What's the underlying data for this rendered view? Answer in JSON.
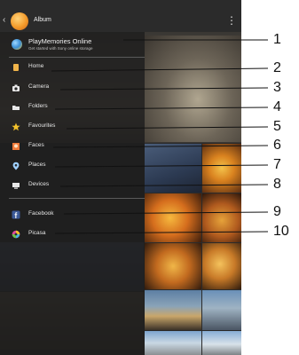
{
  "app": {
    "title": "Album"
  },
  "playmemories": {
    "title": "PlayMemories Online",
    "subtitle": "Get started with Sony online storage"
  },
  "menu": [
    {
      "key": "home",
      "label": "Home",
      "icon": "home-icon",
      "color": "#f0b44a"
    },
    {
      "key": "camera",
      "label": "Camera",
      "icon": "camera-icon",
      "color": "#e8e8e8"
    },
    {
      "key": "folders",
      "label": "Folders",
      "icon": "folder-icon",
      "color": "#e8e8e8"
    },
    {
      "key": "favourites",
      "label": "Favourites",
      "icon": "star-icon",
      "color": "#f3c22b"
    },
    {
      "key": "faces",
      "label": "Faces",
      "icon": "face-icon",
      "color": "#f07a3a"
    },
    {
      "key": "places",
      "label": "Places",
      "icon": "location-pin-icon",
      "color": "#9fd0ff"
    },
    {
      "key": "devices",
      "label": "Devices",
      "icon": "devices-icon",
      "color": "#e8e8e8"
    },
    {
      "key": "facebook",
      "label": "Facebook",
      "icon": "facebook-icon",
      "color": "#3b5998"
    },
    {
      "key": "picasa",
      "label": "Picasa",
      "icon": "picasa-icon",
      "color": "#e04b9c"
    }
  ],
  "callouts": [
    "1",
    "2",
    "3",
    "4",
    "5",
    "6",
    "7",
    "8",
    "9",
    "10"
  ]
}
